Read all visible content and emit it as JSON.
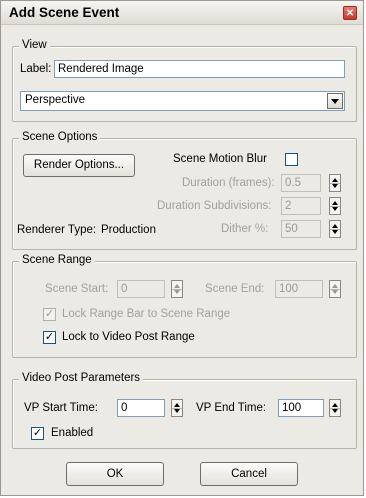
{
  "dialog": {
    "title": "Add Scene Event",
    "close_icon": "close-icon"
  },
  "view": {
    "legend": "View",
    "label_caption": "Label:",
    "label_value": "Rendered Image",
    "viewport_selected": "Perspective"
  },
  "scene_options": {
    "legend": "Scene Options",
    "render_options_label": "Render Options...",
    "motion_blur_label": "Scene Motion Blur",
    "motion_blur_checked": false,
    "duration_label": "Duration (frames):",
    "duration_value": "0.5",
    "subdivisions_label": "Duration Subdivisions:",
    "subdivisions_value": "2",
    "renderer_type_label": "Renderer Type:",
    "renderer_type_value": "Production",
    "dither_label": "Dither %:",
    "dither_value": "50"
  },
  "scene_range": {
    "legend": "Scene Range",
    "start_label": "Scene Start:",
    "start_value": "0",
    "end_label": "Scene End:",
    "end_value": "100",
    "lock_range_bar_label": "Lock Range Bar to Scene Range",
    "lock_range_bar_checked": true,
    "lock_video_post_label": "Lock to Video Post Range",
    "lock_video_post_checked": true
  },
  "video_post": {
    "legend": "Video Post Parameters",
    "vp_start_label": "VP Start Time:",
    "vp_start_value": "0",
    "vp_end_label": "VP End Time:",
    "vp_end_value": "100",
    "enabled_label": "Enabled",
    "enabled_checked": true
  },
  "buttons": {
    "ok": "OK",
    "cancel": "Cancel"
  }
}
